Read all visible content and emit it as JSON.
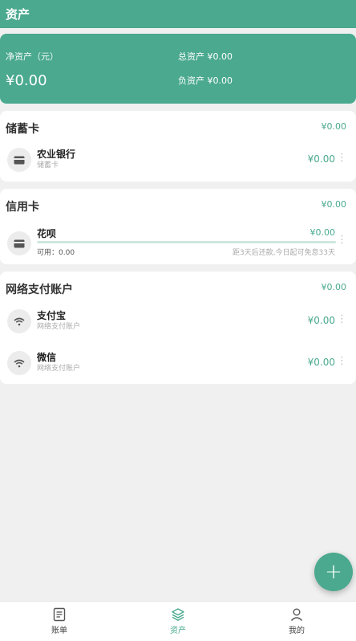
{
  "header": {
    "title": "资产"
  },
  "summary": {
    "net_label": "净资产（元）",
    "net_value": "¥0.00",
    "total_label": "总资产 ¥0.00",
    "debt_label": "负资产 ¥0.00"
  },
  "savings": {
    "title": "储蓄卡",
    "total": "¥0.00",
    "items": [
      {
        "name": "农业银行",
        "sub": "储蓄卡",
        "amount": "¥0.00"
      }
    ]
  },
  "credit": {
    "title": "信用卡",
    "total": "¥0.00",
    "item": {
      "name": "花呗",
      "amount": "¥0.00",
      "available": "可用：0.00",
      "hint": "距3天后还款,今日起可免息33天"
    }
  },
  "online": {
    "title": "网络支付账户",
    "total": "¥0.00",
    "items": [
      {
        "name": "支付宝",
        "sub": "网络支付账户",
        "amount": "¥0.00"
      },
      {
        "name": "微信",
        "sub": "网络支付账户",
        "amount": "¥0.00"
      }
    ]
  },
  "fab": {
    "label": "+"
  },
  "nav": {
    "items": [
      {
        "label": "账单",
        "icon": "bill-icon"
      },
      {
        "label": "资产",
        "icon": "assets-icon",
        "active": true
      },
      {
        "label": "我的",
        "icon": "profile-icon"
      }
    ]
  },
  "colors": {
    "accent": "#4aa98e",
    "background": "#f0f0f0"
  }
}
